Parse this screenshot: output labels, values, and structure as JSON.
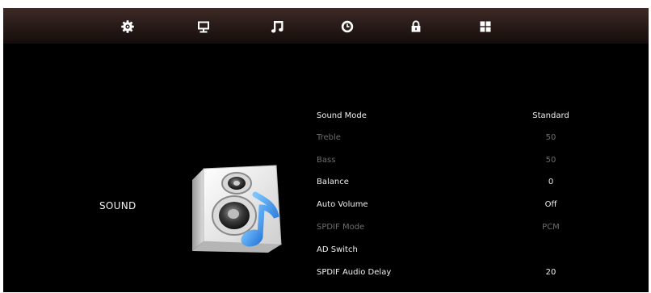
{
  "menu_tabs": [
    {
      "name": "picture",
      "icon": "gear-icon"
    },
    {
      "name": "screen",
      "icon": "monitor-icon"
    },
    {
      "name": "sound",
      "icon": "music-note-icon",
      "selected": true
    },
    {
      "name": "time",
      "icon": "clock-icon"
    },
    {
      "name": "lock",
      "icon": "padlock-icon"
    },
    {
      "name": "setup",
      "icon": "grid-icon"
    }
  ],
  "section": {
    "title": "SOUND",
    "icon": "speaker-music-icon"
  },
  "settings": [
    {
      "label": "Sound Mode",
      "value": "Standard",
      "enabled": true
    },
    {
      "label": "Treble",
      "value": "50",
      "enabled": false
    },
    {
      "label": "Bass",
      "value": "50",
      "enabled": false
    },
    {
      "label": "Balance",
      "value": "0",
      "enabled": true
    },
    {
      "label": "Auto Volume",
      "value": "Off",
      "enabled": true
    },
    {
      "label": "SPDIF Mode",
      "value": "PCM",
      "enabled": false
    },
    {
      "label": "AD Switch",
      "value": "",
      "enabled": true
    },
    {
      "label": "SPDIF Audio Delay",
      "value": "20",
      "enabled": true
    }
  ],
  "colors": {
    "background": "#000000",
    "text": "#f0f0f0",
    "disabled_text": "#6e6e6e",
    "accent_blue": "#2a8ff0"
  }
}
